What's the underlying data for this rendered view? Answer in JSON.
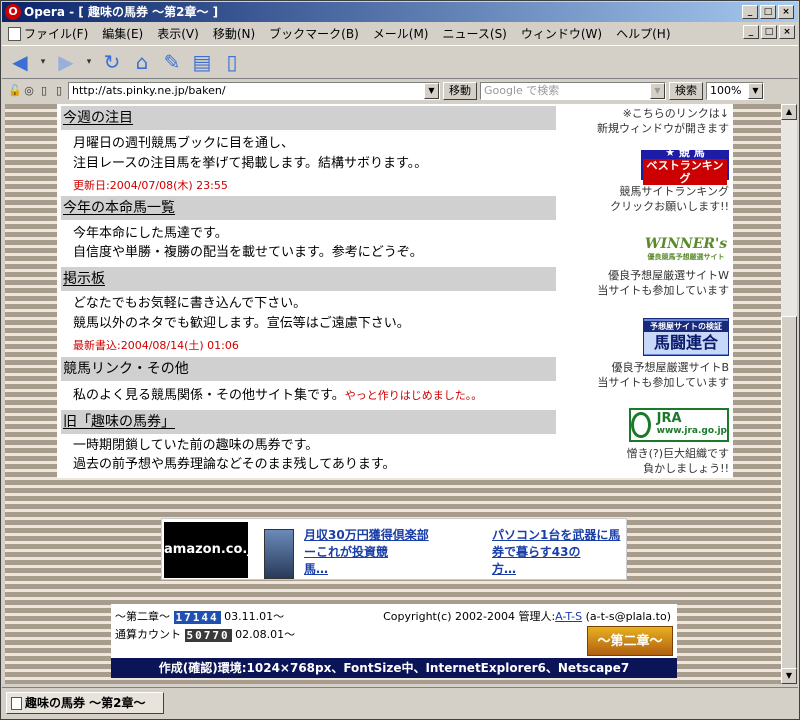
{
  "window": {
    "title": "Opera - [ 趣味の馬券 ～第2章～ ]",
    "controls": [
      "_",
      "□",
      "×"
    ]
  },
  "menu": [
    "ファイル(F)",
    "編集(E)",
    "表示(V)",
    "移動(N)",
    "ブックマーク(B)",
    "メール(M)",
    "ニュース(S)",
    "ウィンドウ(W)",
    "ヘルプ(H)"
  ],
  "address": {
    "url": "http://ats.pinky.ne.jp/baken/",
    "go_label": "移動",
    "search_placeholder": "Google で検索",
    "search_label": "検索",
    "zoom": "100%"
  },
  "sections": [
    {
      "title": "今週の注目",
      "lines": [
        "月曜日の週刊競馬ブックに目を通し、",
        "注目レースの注目馬を挙げて掲載します。結構サボります。。"
      ],
      "note": "更新日:2004/07/08(木) 23:55"
    },
    {
      "title": "今年の本命馬一覧",
      "lines": [
        "今年本命にした馬達です。",
        "自信度や単勝・複勝の配当を載せています。参考にどうぞ。"
      ]
    },
    {
      "title": "掲示板",
      "lines": [
        "どなたでもお気軽に書き込んで下さい。",
        "競馬以外のネタでも歓迎します。宣伝等はご遠慮下さい。"
      ],
      "note": "最新書込:2004/08/14(土) 01:06"
    },
    {
      "title": "競馬リンク・その他",
      "lines": [
        "私のよく見る競馬関係・その他サイト集です。"
      ],
      "extra": "やっと作りはじめました。。"
    },
    {
      "title": "旧「趣味の馬券」",
      "lines": [
        "一時期閉鎖していた前の趣味の馬券です。",
        "過去の前予想や馬券理論などそのまま残してあります。"
      ]
    }
  ],
  "sidebar": {
    "top_note": [
      "※こちらのリンクは↓",
      "新規ウィンドウが開きます"
    ],
    "banner1": {
      "line1": "★ 競 馬",
      "line2": "ベストランキング",
      "caption": [
        "競馬サイトランキング",
        "クリックお願いします!!"
      ]
    },
    "banner2": {
      "line1": "WINNER's",
      "line2": "優良競馬予想厳選サイト",
      "caption": [
        "優良予想屋厳選サイトW",
        "当サイトも参加しています"
      ]
    },
    "banner3": {
      "line1": "予想屋サイトの検証",
      "line2": "馬闘連合",
      "caption": [
        "優良予想屋厳選サイトB",
        "当サイトも参加しています"
      ]
    },
    "banner4": {
      "line1": "JRA",
      "line2": "www.jra.go.jp",
      "caption": [
        "憎き(?)巨大組織です",
        "負かしましょう!!"
      ]
    }
  },
  "ad": {
    "amazon": "amazon.co.jp",
    "link1": [
      "月収30万円獲得倶楽部",
      "ーこれが投資競",
      "馬…"
    ],
    "link2": [
      "パソコン1台を武器に馬",
      "券で暮らす43の",
      "方…"
    ]
  },
  "footer": {
    "chapter_label": "～第二章～",
    "chapter_count": "17144",
    "chapter_date": "03.11.01～",
    "total_label": "通算カウント",
    "total_count": "50770",
    "total_date": "02.08.01～",
    "copyright": "Copyright(c) 2002-2004 管理人:",
    "admin": "A-T-S",
    "email": "(a-t-s@plala.to)",
    "logo": "～第二章～",
    "env": "作成(確認)環境:1024×768px、FontSize中、InternetExplorer6、Netscape7"
  },
  "tab": {
    "label": "趣味の馬券 ～第2章～"
  }
}
